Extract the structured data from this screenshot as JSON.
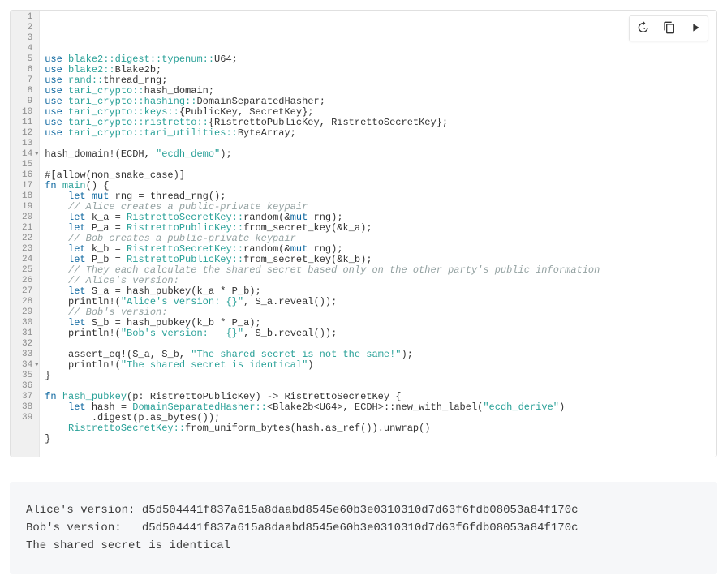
{
  "toolbar": {
    "history_label": "History",
    "copy_label": "Copy",
    "run_label": "Run"
  },
  "code": {
    "line_count": 39,
    "fold_lines": [
      14,
      34
    ],
    "tokens": [
      [],
      [
        [
          "k",
          "use "
        ],
        [
          "ns",
          "blake2::digest::typenum::"
        ],
        [
          "id",
          "U64"
        ],
        [
          "p",
          ";"
        ]
      ],
      [
        [
          "k",
          "use "
        ],
        [
          "ns",
          "blake2::"
        ],
        [
          "id",
          "Blake2b"
        ],
        [
          "p",
          ";"
        ]
      ],
      [
        [
          "k",
          "use "
        ],
        [
          "ns",
          "rand::"
        ],
        [
          "id",
          "thread_rng"
        ],
        [
          "p",
          ";"
        ]
      ],
      [
        [
          "k",
          "use "
        ],
        [
          "ns",
          "tari_crypto::"
        ],
        [
          "id",
          "hash_domain"
        ],
        [
          "p",
          ";"
        ]
      ],
      [
        [
          "k",
          "use "
        ],
        [
          "ns",
          "tari_crypto::hashing::"
        ],
        [
          "id",
          "DomainSeparatedHasher"
        ],
        [
          "p",
          ";"
        ]
      ],
      [
        [
          "k",
          "use "
        ],
        [
          "ns",
          "tari_crypto::keys::"
        ],
        [
          "p",
          "{"
        ],
        [
          "id",
          "PublicKey"
        ],
        [
          "p",
          ", "
        ],
        [
          "id",
          "SecretKey"
        ],
        [
          "p",
          "};"
        ]
      ],
      [
        [
          "k",
          "use "
        ],
        [
          "ns",
          "tari_crypto::ristretto::"
        ],
        [
          "p",
          "{"
        ],
        [
          "id",
          "RistrettoPublicKey"
        ],
        [
          "p",
          ", "
        ],
        [
          "id",
          "RistrettoSecretKey"
        ],
        [
          "p",
          "};"
        ]
      ],
      [
        [
          "k",
          "use "
        ],
        [
          "ns",
          "tari_crypto::tari_utilities::"
        ],
        [
          "id",
          "ByteArray"
        ],
        [
          "p",
          ";"
        ]
      ],
      [],
      [
        [
          "id",
          "hash_domain"
        ],
        [
          "p",
          "!("
        ],
        [
          "id",
          "ECDH"
        ],
        [
          "p",
          ", "
        ],
        [
          "s",
          "\"ecdh_demo\""
        ],
        [
          "p",
          ");"
        ]
      ],
      [],
      [
        [
          "p",
          "#[allow(non_snake_case)]"
        ]
      ],
      [
        [
          "k",
          "fn "
        ],
        [
          "ns",
          "main"
        ],
        [
          "p",
          "() {"
        ]
      ],
      [
        [
          "p",
          "    "
        ],
        [
          "k",
          "let mut "
        ],
        [
          "id",
          "rng"
        ],
        [
          "p",
          " = thread_rng();"
        ]
      ],
      [
        [
          "p",
          "    "
        ],
        [
          "c",
          "// Alice creates a public-private keypair"
        ]
      ],
      [
        [
          "p",
          "    "
        ],
        [
          "k",
          "let "
        ],
        [
          "id",
          "k_a"
        ],
        [
          "p",
          " = "
        ],
        [
          "ns",
          "RistrettoSecretKey::"
        ],
        [
          "id",
          "random"
        ],
        [
          "p",
          "(&"
        ],
        [
          "k",
          "mut "
        ],
        [
          "id",
          "rng"
        ],
        [
          "p",
          ");"
        ]
      ],
      [
        [
          "p",
          "    "
        ],
        [
          "k",
          "let "
        ],
        [
          "id",
          "P_a"
        ],
        [
          "p",
          " = "
        ],
        [
          "ns",
          "RistrettoPublicKey::"
        ],
        [
          "id",
          "from_secret_key"
        ],
        [
          "p",
          "(&k_a);"
        ]
      ],
      [
        [
          "p",
          "    "
        ],
        [
          "c",
          "// Bob creates a public-private keypair"
        ]
      ],
      [
        [
          "p",
          "    "
        ],
        [
          "k",
          "let "
        ],
        [
          "id",
          "k_b"
        ],
        [
          "p",
          " = "
        ],
        [
          "ns",
          "RistrettoSecretKey::"
        ],
        [
          "id",
          "random"
        ],
        [
          "p",
          "(&"
        ],
        [
          "k",
          "mut "
        ],
        [
          "id",
          "rng"
        ],
        [
          "p",
          ");"
        ]
      ],
      [
        [
          "p",
          "    "
        ],
        [
          "k",
          "let "
        ],
        [
          "id",
          "P_b"
        ],
        [
          "p",
          " = "
        ],
        [
          "ns",
          "RistrettoPublicKey::"
        ],
        [
          "id",
          "from_secret_key"
        ],
        [
          "p",
          "(&k_b);"
        ]
      ],
      [
        [
          "p",
          "    "
        ],
        [
          "c",
          "// They each calculate the shared secret based only on the other party's public information"
        ]
      ],
      [
        [
          "p",
          "    "
        ],
        [
          "c",
          "// Alice's version:"
        ]
      ],
      [
        [
          "p",
          "    "
        ],
        [
          "k",
          "let "
        ],
        [
          "id",
          "S_a"
        ],
        [
          "p",
          " = hash_pubkey(k_a * P_b);"
        ]
      ],
      [
        [
          "p",
          "    "
        ],
        [
          "id",
          "println"
        ],
        [
          "p",
          "!("
        ],
        [
          "s",
          "\"Alice's version: {}\""
        ],
        [
          "p",
          ", S_a.reveal());"
        ]
      ],
      [
        [
          "p",
          "    "
        ],
        [
          "c",
          "// Bob's version:"
        ]
      ],
      [
        [
          "p",
          "    "
        ],
        [
          "k",
          "let "
        ],
        [
          "id",
          "S_b"
        ],
        [
          "p",
          " = hash_pubkey(k_b * P_a);"
        ]
      ],
      [
        [
          "p",
          "    "
        ],
        [
          "id",
          "println"
        ],
        [
          "p",
          "!("
        ],
        [
          "s",
          "\"Bob's version:   {}\""
        ],
        [
          "p",
          ", S_b.reveal());"
        ]
      ],
      [],
      [
        [
          "p",
          "    "
        ],
        [
          "id",
          "assert_eq"
        ],
        [
          "p",
          "!(S_a, S_b, "
        ],
        [
          "s",
          "\"The shared secret is not the same!\""
        ],
        [
          "p",
          ");"
        ]
      ],
      [
        [
          "p",
          "    "
        ],
        [
          "id",
          "println"
        ],
        [
          "p",
          "!("
        ],
        [
          "s",
          "\"The shared secret is identical\""
        ],
        [
          "p",
          ")"
        ]
      ],
      [
        [
          "p",
          "}"
        ]
      ],
      [],
      [
        [
          "k",
          "fn "
        ],
        [
          "ns",
          "hash_pubkey"
        ],
        [
          "p",
          "(p: RistrettoPublicKey) -> RistrettoSecretKey {"
        ]
      ],
      [
        [
          "p",
          "    "
        ],
        [
          "k",
          "let "
        ],
        [
          "id",
          "hash"
        ],
        [
          "p",
          " = "
        ],
        [
          "ns",
          "DomainSeparatedHasher::"
        ],
        [
          "p",
          "<"
        ],
        [
          "id",
          "Blake2b"
        ],
        [
          "p",
          "<"
        ],
        [
          "id",
          "U64"
        ],
        [
          "p",
          ">, ECDH>::new_with_label("
        ],
        [
          "s",
          "\"ecdh_derive\""
        ],
        [
          "p",
          ")"
        ]
      ],
      [
        [
          "p",
          "        .digest(p.as_bytes());"
        ]
      ],
      [
        [
          "p",
          "    "
        ],
        [
          "ns",
          "RistrettoSecretKey::"
        ],
        [
          "id",
          "from_uniform_bytes"
        ],
        [
          "p",
          "(hash.as_ref()).unwrap()"
        ]
      ],
      [
        [
          "p",
          "}"
        ]
      ],
      []
    ]
  },
  "output": {
    "lines": [
      "Alice's version: d5d504441f837a615a8daabd8545e60b3e0310310d7d63f6fdb08053a84f170c",
      "Bob's version:   d5d504441f837a615a8daabd8545e60b3e0310310d7d63f6fdb08053a84f170c",
      "The shared secret is identical"
    ]
  }
}
